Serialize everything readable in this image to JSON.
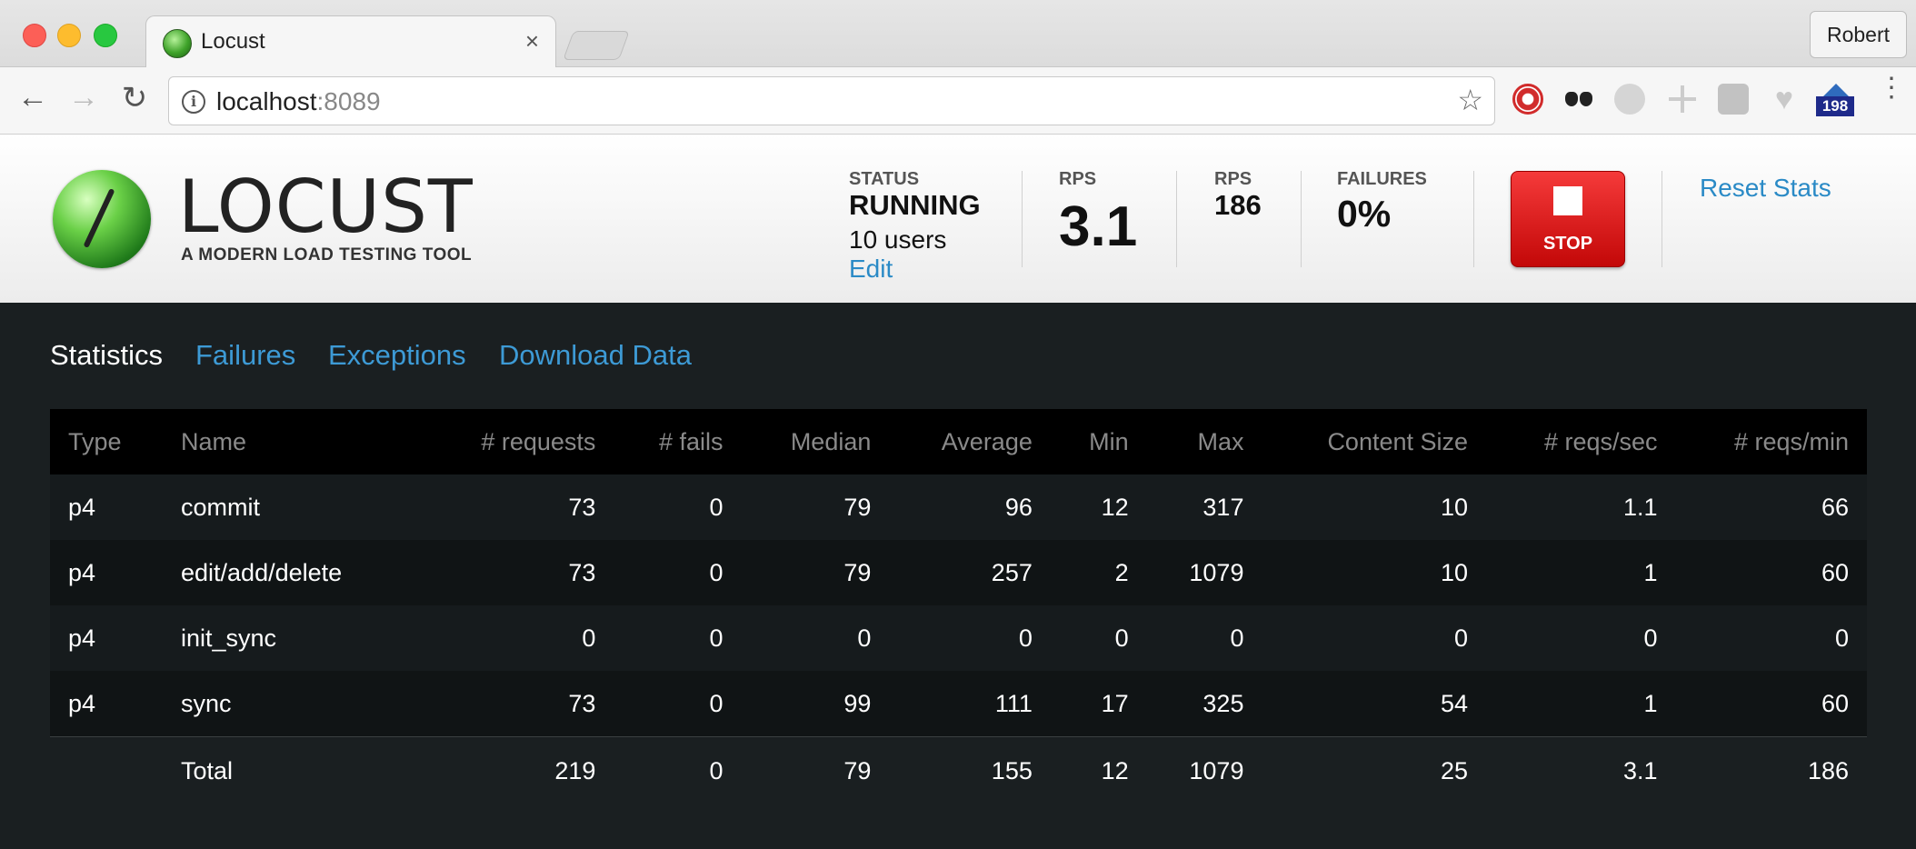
{
  "browser": {
    "tab_title": "Locust",
    "tab_close": "×",
    "profile_name": "Robert",
    "url_host": "localhost",
    "url_port": ":8089",
    "back": "←",
    "forward": "→",
    "reload": "↻",
    "info": "i",
    "star": "☆",
    "menu": "⋮",
    "extension_badge": "198",
    "extension_icons": [
      "stopwatch-icon",
      "ghostery-icon",
      "globe-icon",
      "sparkle-icon",
      "shield-icon",
      "heart-icon",
      "home-icon"
    ]
  },
  "header": {
    "logo_text": "LOCUST",
    "tagline": "A MODERN LOAD TESTING TOOL",
    "status_label": "STATUS",
    "status_value": "RUNNING",
    "users": "10 users",
    "edit": "Edit",
    "rps_label": "RPS",
    "rps_value": "3.1",
    "rpm_label": "RPS",
    "rpm_value": "186",
    "failures_label": "FAILURES",
    "failures_value": "0%",
    "stop_label": "STOP",
    "reset": "Reset Stats",
    "stop_color": "#e21b1b",
    "link_color": "#2a8ac6"
  },
  "nav": {
    "tabs": [
      "Statistics",
      "Failures",
      "Exceptions",
      "Download Data"
    ],
    "active": "Statistics"
  },
  "table": {
    "columns": [
      "Type",
      "Name",
      "# requests",
      "# fails",
      "Median",
      "Average",
      "Min",
      "Max",
      "Content Size",
      "# reqs/sec",
      "# reqs/min"
    ],
    "rows": [
      [
        "p4",
        "commit",
        "73",
        "0",
        "79",
        "96",
        "12",
        "317",
        "10",
        "1.1",
        "66"
      ],
      [
        "p4",
        "edit/add/delete",
        "73",
        "0",
        "79",
        "257",
        "2",
        "1079",
        "10",
        "1",
        "60"
      ],
      [
        "p4",
        "init_sync",
        "0",
        "0",
        "0",
        "0",
        "0",
        "0",
        "0",
        "0",
        "0"
      ],
      [
        "p4",
        "sync",
        "73",
        "0",
        "99",
        "111",
        "17",
        "325",
        "54",
        "1",
        "60"
      ]
    ],
    "total": [
      "",
      "Total",
      "219",
      "0",
      "79",
      "155",
      "12",
      "1079",
      "25",
      "3.1",
      "186"
    ]
  }
}
